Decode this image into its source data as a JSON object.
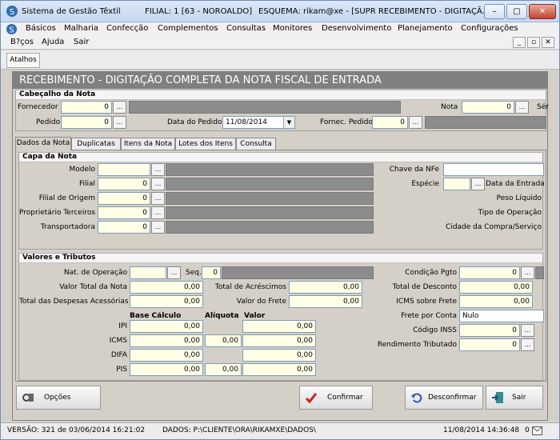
{
  "window": {
    "app_title": "Sistema de Gestão Têxtil",
    "filial": "FILIAL: 1 [63 - NOROALDO]",
    "esquema": "ESQUEMA: rikam@xe - [SUPR RECEBIMENTO - DIGITAÇÃ...",
    "minimize_label": "–",
    "maximize_label": "▢",
    "close_label": "✕"
  },
  "menu": [
    "Básicos",
    "Malharia",
    "Confecção",
    "Complementos",
    "Consultas",
    "Monitores",
    "Desenvolvimento",
    "Planejamento",
    "Configurações"
  ],
  "menu2": [
    "B?ços",
    "Ajuda",
    "Sair"
  ],
  "mdi_controls": [
    "_",
    "▫",
    "✕"
  ],
  "shortcuts": {
    "label": "Atalhos"
  },
  "form": {
    "title": "RECEBIMENTO - DIGITAÇÃO COMPLETA DA NOTA FISCAL DE ENTRADA",
    "header": {
      "section": "Cabeçalho da Nota",
      "fornecedor_label": "Fornecedor",
      "fornecedor_value": "0",
      "nota_label": "Nota",
      "nota_value": "0",
      "serie_label": "Sér",
      "pedido_label": "Pedido",
      "pedido_value": "0",
      "data_pedido_label": "Data do Pedido",
      "data_pedido_value": "11/08/2014",
      "fornec_pedido_label": "Fornec. Pedido",
      "fornec_pedido_value": "0"
    },
    "tabs": [
      "Dados da Nota",
      "Duplicatas",
      "Itens da Nota",
      "Lotes dos Itens",
      "Consulta"
    ],
    "capa": {
      "section": "Capa da Nota",
      "modelo_label": "Modelo",
      "filial_label": "Filial",
      "filial_value": "0",
      "filial_origem_label": "Filial de Origem",
      "filial_origem_value": "0",
      "proprietario_label": "Proprietário Terceiros",
      "proprietario_value": "0",
      "transportadora_label": "Transportadora",
      "transportadora_value": "0",
      "chave_label": "Chave da NFe",
      "especie_label": "Espécie",
      "data_entrada_label": "Data da Entrada",
      "peso_label": "Peso Líquido",
      "tipo_operacao_label": "Tipo de Operação",
      "cidade_label": "Cidade da Compra/Serviço"
    },
    "valores": {
      "section": "Valores e Tributos",
      "nat_operacao_label": "Nat. de Operação",
      "seq_label": "Seq.",
      "seq_value": "0",
      "valor_total_label": "Valor Total da Nota",
      "valor_total_value": "0,00",
      "total_acrescimos_label": "Total de Acréscimos",
      "total_acrescimos_value": "0,00",
      "despesas_label": "Total das Despesas Acessórias",
      "despesas_value": "0,00",
      "valor_frete_label": "Valor do Frete",
      "valor_frete_value": "0,00",
      "col_base": "Base Cálculo",
      "col_aliquota": "Alíquota",
      "col_valor": "Valor",
      "ipi_label": "IPI",
      "ipi_base": "0,00",
      "ipi_valor": "0,00",
      "icms_label": "ICMS",
      "icms_base": "0,00",
      "icms_aliquota": "0,00",
      "icms_valor": "0,00",
      "difa_label": "DIFA",
      "difa_base": "0,00",
      "difa_valor": "0,00",
      "pis_label": "PIS",
      "pis_base": "0,00",
      "pis_aliquota": "0,00",
      "pis_valor": "0,00",
      "cond_pgto_label": "Condição Pgto",
      "cond_pgto_value": "0",
      "total_desconto_label": "Total de Desconto",
      "total_desconto_value": "0,00",
      "icms_frete_label": "ICMS sobre Frete",
      "icms_frete_value": "0,00",
      "frete_conta_label": "Frete por Conta",
      "frete_conta_value": "Nulo",
      "codigo_inss_label": "Código INSS",
      "codigo_inss_value": "0",
      "rendimento_label": "Rendimento Tributado",
      "rendimento_value": "0"
    },
    "buttons": {
      "opcoes": "Opções",
      "confirmar": "Confirmar",
      "desconfirmar": "Desconfirmar",
      "sair": "Sair"
    },
    "ellipsis": "..."
  },
  "status": {
    "versao": "VERSÃO: 321 de 03/06/2014 16:21:02",
    "dados": "DADOS: P:\\CLIENTE\\ORA\\RIKAMXE\\DADOS\\",
    "datetime": "11/08/2014 14:36:48",
    "msg_count": "0"
  },
  "colors": {
    "title_gray": "#808080",
    "field_yellow": "#ffffe6",
    "confirm_red": "#d0201a"
  }
}
